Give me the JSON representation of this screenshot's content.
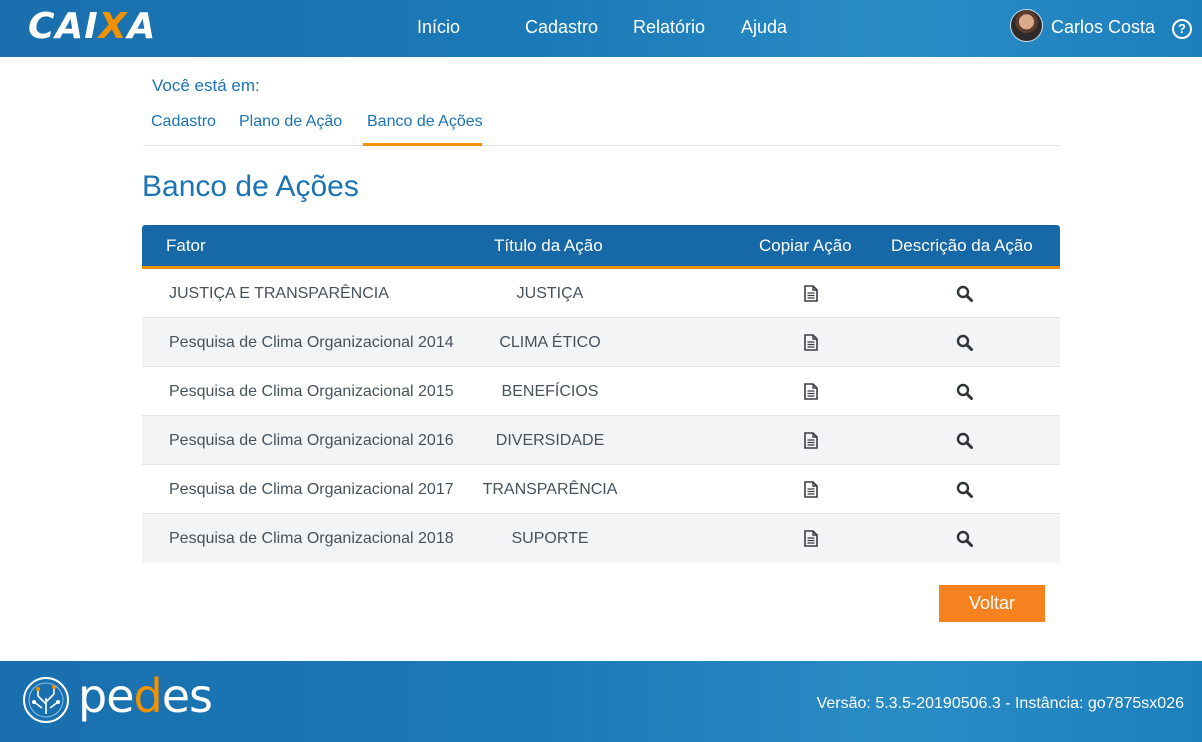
{
  "header": {
    "logo_prefix": "CAI",
    "logo_x": "X",
    "logo_suffix": "A",
    "nav": [
      "Início",
      "Cadastro",
      "Relatório",
      "Ajuda"
    ],
    "user_name": "Carlos Costa",
    "help_symbol": "?"
  },
  "breadcrumb": {
    "label": "Você está em:",
    "items": [
      "Cadastro",
      "Plano de Ação",
      "Banco de Ações"
    ]
  },
  "page": {
    "title": "Banco de Ações"
  },
  "table": {
    "headers": [
      "Fator",
      "Título da Ação",
      "Copiar Ação",
      "Descrição da Ação"
    ],
    "rows": [
      {
        "fator": "JUSTIÇA E TRANSPARÊNCIA",
        "titulo": "JUSTIÇA"
      },
      {
        "fator": "Pesquisa de Clima Organizacional 2014",
        "titulo": "CLIMA ÉTICO"
      },
      {
        "fator": "Pesquisa de Clima Organizacional 2015",
        "titulo": "BENEFÍCIOS"
      },
      {
        "fator": "Pesquisa de Clima Organizacional 2016",
        "titulo": "DIVERSIDADE"
      },
      {
        "fator": "Pesquisa de Clima Organizacional 2017",
        "titulo": "TRANSPARÊNCIA"
      },
      {
        "fator": "Pesquisa de Clima Organizacional 2018",
        "titulo": "SUPORTE"
      }
    ],
    "copy_icon": "document-icon",
    "description_icon": "search-icon"
  },
  "actions": {
    "back_label": "Voltar"
  },
  "footer": {
    "brand_pre": "pe",
    "brand_o": "d",
    "brand_post": "es",
    "version": "Versão: 5.3.5-20190506.3 - Instância: go7875sx026"
  },
  "colors": {
    "primary": "#1668a6",
    "accent": "#f39200",
    "link": "#1b74b4"
  }
}
